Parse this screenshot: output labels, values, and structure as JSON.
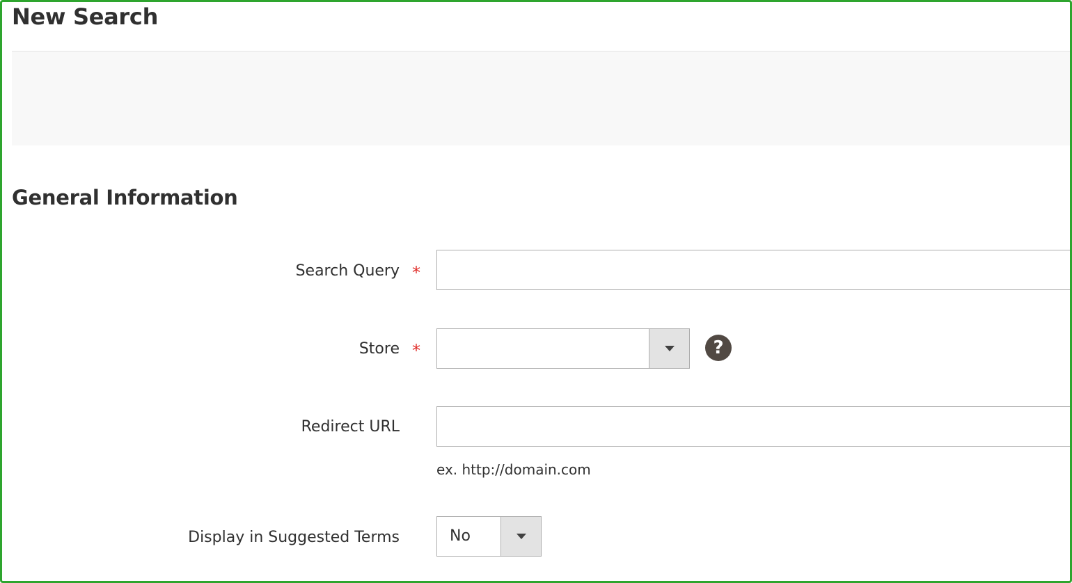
{
  "page": {
    "title": "New Search"
  },
  "section": {
    "title": "General Information"
  },
  "form": {
    "search_query": {
      "label": "Search Query",
      "required_mark": "*",
      "value": "",
      "placeholder": ""
    },
    "store": {
      "label": "Store",
      "required_mark": "*",
      "selected": "",
      "help_icon": "question-circle-icon",
      "help_glyph": "?"
    },
    "redirect_url": {
      "label": "Redirect URL",
      "value": "",
      "placeholder": "",
      "note": "ex. http://domain.com"
    },
    "display_in_suggested_terms": {
      "label": "Display in Suggested Terms",
      "selected": "No"
    }
  },
  "colors": {
    "frame": "#2ea52e",
    "required": "#e02b27",
    "help_icon_bg": "#514943",
    "actions_bar_bg": "#f8f8f8"
  }
}
